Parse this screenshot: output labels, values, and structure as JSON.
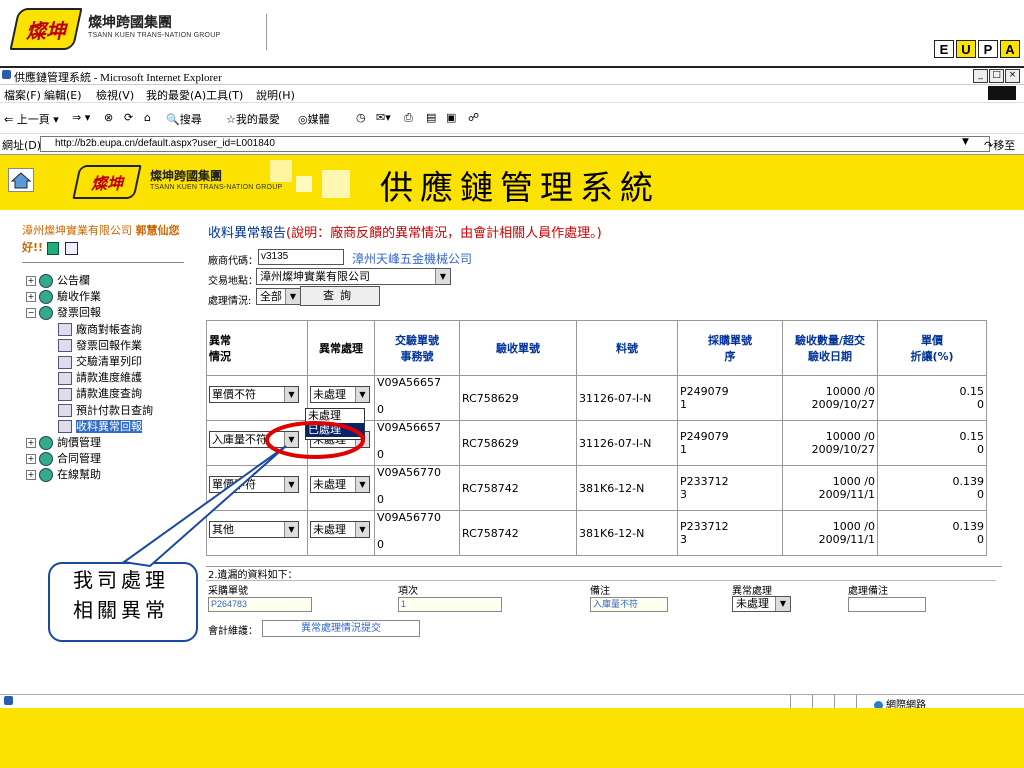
{
  "slide_header": {
    "logo_mark": "燦坤",
    "group_name_cn": "燦坤跨國集團",
    "group_name_en": "TSANN KUEN TRANS-NATION GROUP",
    "brand_letters": [
      "E",
      "U",
      "P",
      "A"
    ]
  },
  "browser": {
    "window_title": "供應鏈管理系統 - Microsoft Internet Explorer",
    "menu": [
      "檔案(F)",
      "編輯(E)",
      "檢視(V)",
      "我的最愛(A)",
      "工具(T)",
      "說明(H)"
    ],
    "toolbar": {
      "back": "上一頁",
      "search": "搜尋",
      "favorites": "我的最愛",
      "media": "媒體"
    },
    "address_label": "網址(D)",
    "address_url": "http://b2b.eupa.cn/default.aspx?user_id=L001840",
    "go_label": "移至",
    "status_zone": "網際網路",
    "window_buttons": [
      "_",
      "□",
      "×"
    ]
  },
  "banner": {
    "logo_mark": "燦坤",
    "group_name_cn": "燦坤跨國集團",
    "group_name_en": "TSANN KUEN TRANS-NATION GROUP",
    "system_title": "供應鏈管理系統"
  },
  "sidebar": {
    "company": "漳州燦坤實業有限公司",
    "user": "郭慧仙您好!!",
    "tree": [
      {
        "label": "公告欄",
        "level": 0,
        "expander": "+"
      },
      {
        "label": "驗收作業",
        "level": 0,
        "expander": "+"
      },
      {
        "label": "發票回報",
        "level": 0,
        "expander": "-"
      },
      {
        "label": "廠商對帳查詢",
        "level": 1
      },
      {
        "label": "發票回報作業",
        "level": 1
      },
      {
        "label": "交驗清單列印",
        "level": 1
      },
      {
        "label": "請款進度維護",
        "level": 1
      },
      {
        "label": "請款進度查詢",
        "level": 1
      },
      {
        "label": "預計付款日查詢",
        "level": 1
      },
      {
        "label": "收料異常回報",
        "level": 1,
        "selected": true
      },
      {
        "label": "詢價管理",
        "level": 0,
        "expander": "+"
      },
      {
        "label": "合同管理",
        "level": 0,
        "expander": "+"
      },
      {
        "label": "在線幫助",
        "level": 0,
        "expander": "+"
      }
    ]
  },
  "report": {
    "title": "收料異常報告",
    "description": "(說明：廠商反饋的異常情況，由會計相關人員作處理。)",
    "vendor_code_label": "廠商代碼：",
    "vendor_code": "v3135",
    "vendor_name": "漳州天峰五金機械公司",
    "location_label": "交易地點：",
    "location": "漳州燦坤實業有限公司",
    "status_label": "處理情況:",
    "status": "全部",
    "query_button": "查詢"
  },
  "grid": {
    "headers": [
      "異常\n情況",
      "異常處理",
      "交驗單號\n事務號",
      "驗收單號",
      "料號",
      "採購單號\n序",
      "驗收數量/超交\n驗收日期",
      "單價\n折讓(%)"
    ],
    "rows": [
      {
        "abnormal": "單價不符",
        "handling": "未處理",
        "doc": "V09A56657",
        "doc2": "0",
        "receipt": "RC758629",
        "part": "31126-07-I-N",
        "po": "P249079",
        "po_seq": "1",
        "qty": "10000 /0",
        "date": "2009/10/27",
        "price": "0.15",
        "discount": "0"
      },
      {
        "abnormal": "入庫量不符",
        "handling": "未處理",
        "doc": "V09A56657",
        "doc2": "0",
        "receipt": "RC758629",
        "part": "31126-07-I-N",
        "po": "P249079",
        "po_seq": "1",
        "qty": "10000 /0",
        "date": "2009/10/27",
        "price": "0.15",
        "discount": "0"
      },
      {
        "abnormal": "單價不符",
        "handling": "未處理",
        "doc": "V09A56770",
        "doc2": "0",
        "receipt": "RC758742",
        "part": "381K6-12-N",
        "po": "P233712",
        "po_seq": "3",
        "qty": "1000 /0",
        "date": "2009/11/1",
        "price": "0.139",
        "discount": "0"
      },
      {
        "abnormal": "其他",
        "handling": "未處理",
        "doc": "V09A56770",
        "doc2": "0",
        "receipt": "RC758742",
        "part": "381K6-12-N",
        "po": "P233712",
        "po_seq": "3",
        "qty": "1000 /0",
        "date": "2009/11/1",
        "price": "0.139",
        "discount": "0"
      }
    ],
    "dropdown_options": [
      "未處理",
      "已處理"
    ],
    "dropdown_highlight": "已處理"
  },
  "missing": {
    "heading": "2.遺漏的資料如下：",
    "col_po": "采購單號",
    "col_item": "項次",
    "col_note": "備注",
    "col_handling": "異常處理",
    "col_handling_note": "處理備注",
    "po_value": "P264783",
    "item_value": "1",
    "note_value": "入庫量不符",
    "handling_value": "未處理",
    "confirm_label": "會計維護：",
    "submit_button": "異常處理情況提交"
  },
  "callout": {
    "line1": "我司處理",
    "line2": "相關異常"
  },
  "colors": {
    "brand_yellow": "#fce200",
    "link_blue": "#003399",
    "note_red": "#cc0000",
    "callout_blue": "#1a4aa0",
    "highlight_red": "#e00000"
  }
}
